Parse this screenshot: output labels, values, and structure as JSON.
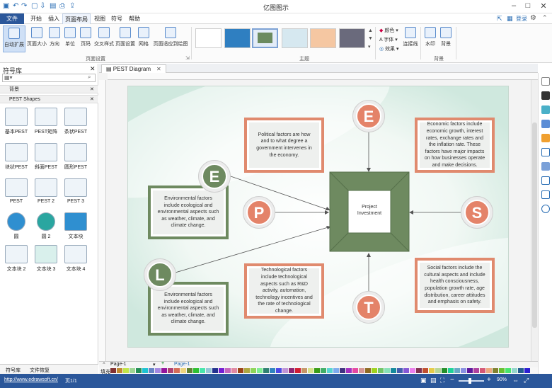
{
  "app": {
    "title": "亿图图示"
  },
  "menu": {
    "file": "文件",
    "items": [
      "开始",
      "插入",
      "页面布局",
      "视图",
      "符号",
      "帮助"
    ],
    "login": "登录"
  },
  "ribbon": {
    "buttons": [
      "自动扩展",
      "页面大小",
      "方向",
      "单位",
      "页码",
      "交叉样式",
      "页面设置",
      "网格",
      "页面适应到绘图"
    ],
    "group_page": "页面设置",
    "group_theme": "主题",
    "group_bg": "背景",
    "options": [
      "颜色",
      "字体",
      "效果"
    ],
    "connector": "连接线",
    "watermark": "水印",
    "background": "背景"
  },
  "library": {
    "title": "符号库",
    "search_placeholder": "",
    "section_bg": "背景",
    "section_pest": "PEST Shapes",
    "shapes": [
      "基本PEST",
      "PEST矩阵",
      "条状PEST",
      "块状PEST",
      "斜面PEST",
      "圆形PEST",
      "PEST",
      "PEST 2",
      "PEST 3",
      "圆",
      "圆 2",
      "文本块",
      "文本块 2",
      "文本块 3",
      "文本块 4"
    ],
    "bottom_tabs": [
      "符号库",
      "文件恢复"
    ]
  },
  "doc": {
    "tab": "PEST Diagram"
  },
  "diagram": {
    "center": "Project Investment",
    "letters": [
      "E",
      "E",
      "P",
      "S",
      "L",
      "T"
    ],
    "political": "Political factors are how and to what degree a government intervenes in the economy.",
    "economic": "Economic factors include economic growth, interest rates, exchange rates and the inflation rate. These factors have major impacts on how businesses operate and make decisions.",
    "env1": "Environmental factors include ecological and environmental aspects such as weather, climate, and climate change.",
    "env2": "Environmental factors include ecological and environmental aspects such as weather, climate, and climate change.",
    "technological": "Technological factors include technological aspects such as R&D activity, automation, technology incentives and the rate of technological change.",
    "social": "Social factors include the cultural aspects and include health consciousness, population growth rate, age distribution, career attitudes and emphasis on safety."
  },
  "pages": {
    "current": "Page-1",
    "tab": "Page-1"
  },
  "fill_label": "填充",
  "status": {
    "url": "http://www.edrawsoft.cn/",
    "page": "页1/1",
    "zoom": "90%"
  },
  "colors": {
    "accent": "#2b579a",
    "orange": "#e08a6e",
    "green": "#6e8a60"
  }
}
